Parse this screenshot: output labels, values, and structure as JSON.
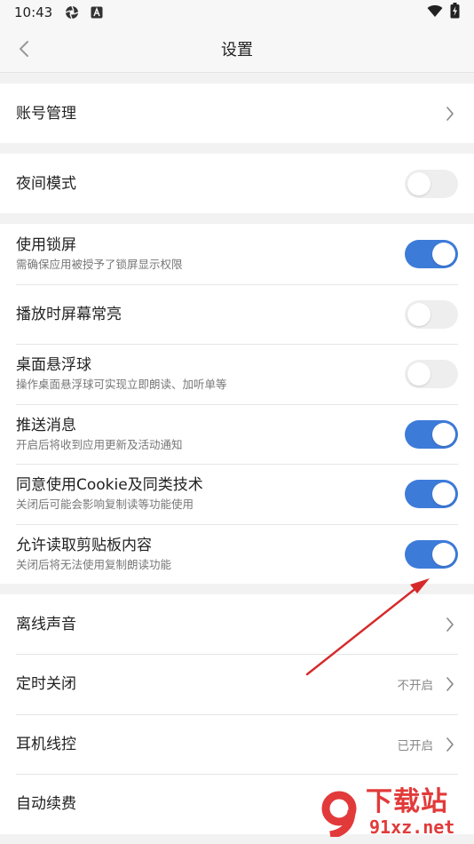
{
  "status_bar": {
    "time": "10:43",
    "icons": [
      "aperture-icon",
      "a-square-icon",
      "wifi-icon",
      "battery-charging-icon"
    ]
  },
  "header": {
    "title": "设置"
  },
  "groups": {
    "account": {
      "label": "账号管理"
    },
    "night": {
      "label": "夜间模式",
      "enabled": false
    },
    "toggles": {
      "lockscreen": {
        "label": "使用锁屏",
        "sub": "需确保应用被授予了锁屏显示权限",
        "enabled": true
      },
      "screen_on": {
        "label": "播放时屏幕常亮",
        "enabled": false
      },
      "float_ball": {
        "label": "桌面悬浮球",
        "sub": "操作桌面悬浮球可实现立即朗读、加听单等",
        "enabled": false
      },
      "push": {
        "label": "推送消息",
        "sub": "开启后将收到应用更新及活动通知",
        "enabled": true
      },
      "cookie": {
        "label": "同意使用Cookie及同类技术",
        "sub": "关闭后可能会影响复制读等功能使用",
        "enabled": true
      },
      "clipboard": {
        "label": "允许读取剪贴板内容",
        "sub": "关闭后将无法使用复制朗读功能",
        "enabled": true
      }
    },
    "misc": {
      "offline_voice": {
        "label": "离线声音"
      },
      "timer": {
        "label": "定时关闭",
        "value": "不开启"
      },
      "headset": {
        "label": "耳机线控",
        "value": "已开启"
      },
      "auto_renew": {
        "label": "自动续费"
      }
    }
  },
  "colors": {
    "accent": "#3d7bd9",
    "toggle_off": "#eeeeee",
    "annotation_arrow": "#d62a2a",
    "watermark": "#e23a3a"
  },
  "watermark": {
    "title": "下载站",
    "domain": "91xz.net"
  }
}
